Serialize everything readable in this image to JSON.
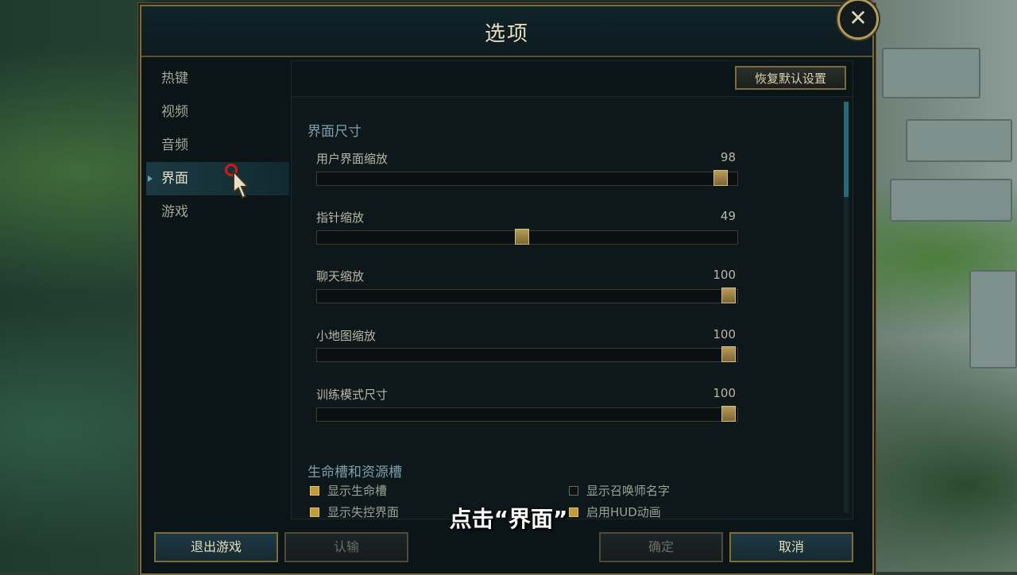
{
  "dialog": {
    "title": "选项",
    "close_glyph": "✕",
    "reset_label": "恢复默认设置"
  },
  "sidebar": {
    "items": [
      {
        "label": "热键"
      },
      {
        "label": "视频"
      },
      {
        "label": "音频"
      },
      {
        "label": "界面",
        "active": true
      },
      {
        "label": "游戏"
      }
    ]
  },
  "section_size": {
    "title": "界面尺寸",
    "sliders": [
      {
        "label": "用户界面缩放",
        "value": "98",
        "fraction": 0.98
      },
      {
        "label": "指针缩放",
        "value": "49",
        "fraction": 0.49
      },
      {
        "label": "聊天缩放",
        "value": "100",
        "fraction": 1.0
      },
      {
        "label": "小地图缩放",
        "value": "100",
        "fraction": 1.0
      },
      {
        "label": "训练模式尺寸",
        "value": "100",
        "fraction": 1.0
      }
    ]
  },
  "section_bars": {
    "title": "生命槽和资源槽",
    "checkboxes": [
      {
        "label": "显示生命槽",
        "checked": true
      },
      {
        "label": "显示召唤师名字",
        "checked": false
      },
      {
        "label": "显示失控界面",
        "checked": true
      },
      {
        "label": "启用HUD动画",
        "checked": true
      }
    ]
  },
  "footer": {
    "exit_label": "退出游戏",
    "surrender_label": "认输",
    "ok_label": "确定",
    "cancel_label": "取消"
  },
  "overlay": {
    "subtitle": "点击“界面”"
  },
  "colors": {
    "accent_gold": "#b39a5b",
    "section_title": "#7d9fab",
    "checkbox_on": "#c49c3e"
  }
}
